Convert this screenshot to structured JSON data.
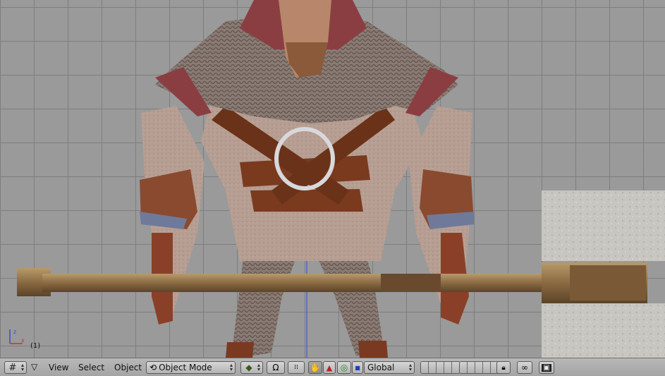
{
  "viewport": {
    "frame_label": "(1)",
    "axes": {
      "x": "x",
      "z": "z"
    }
  },
  "header": {
    "menus": {
      "view": "View",
      "select": "Select",
      "object": "Object"
    },
    "mode_select": {
      "value": "Object Mode"
    },
    "orientation_select": {
      "value": "Global"
    },
    "icons": [
      "grid-icon",
      "collapse-triangle-icon",
      "mode-icon",
      "draw-type-icon",
      "pivot-icon",
      "snap-icon",
      "hand-icon",
      "rotate-icon",
      "scale-icon",
      "lock-icon",
      "link-icon",
      "render-icon"
    ]
  },
  "colors": {
    "header_bg": "#adadad",
    "grid_line": "#7e7e7e",
    "viewport_bg": "#9a9a9a",
    "x_axis": "#d03030",
    "z_axis": "#3050d0"
  }
}
